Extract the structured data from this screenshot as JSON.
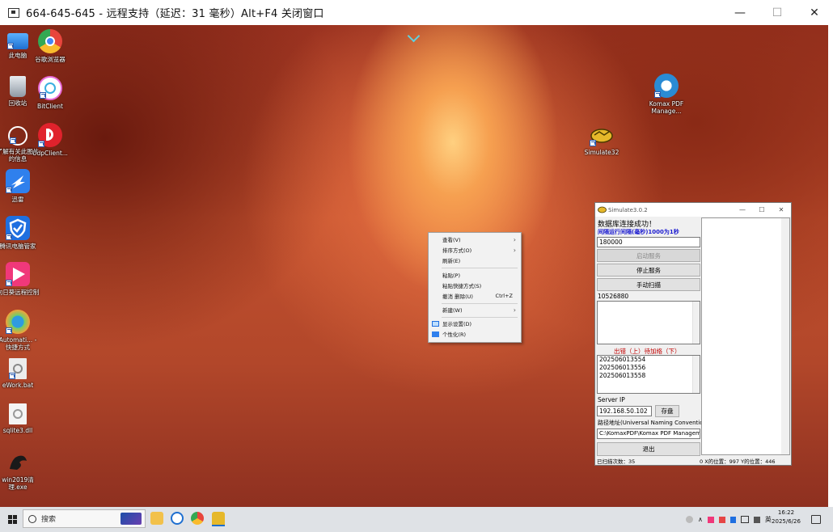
{
  "remote_window": {
    "title": "664-645-645 - 远程支持（延迟：31 毫秒）Alt+F4 关闭窗口",
    "minimize": "—",
    "maximize": "☐",
    "close": "✕"
  },
  "desktop_icons": [
    {
      "label": "此电脑",
      "icon": "computer-icon",
      "color": "#3a8ee6"
    },
    {
      "label": "谷歌浏览器",
      "icon": "chrome-icon",
      "color": "#e8453c"
    },
    {
      "label": "回收站",
      "icon": "recycle-bin-icon",
      "color": "#9aa6b2"
    },
    {
      "label": "BitClient",
      "icon": "bitclient-icon",
      "color": "#e86bd8"
    },
    {
      "label": "了解有关此图片的信息",
      "icon": "info-circle-icon",
      "color": "#ffffff"
    },
    {
      "label": "UdpClient...",
      "icon": "udpclient-icon",
      "color": "#e0222c"
    },
    {
      "label": "迅雷",
      "icon": "thunder-icon",
      "color": "#2f80ed"
    },
    {
      "label": "腾讯电脑管家",
      "icon": "shield-icon",
      "color": "#1f6fe0"
    },
    {
      "label": "向日葵远程控制",
      "icon": "sunlogin-icon",
      "color": "#f0387a"
    },
    {
      "label": "Automati... - 快捷方式",
      "icon": "automation-icon",
      "color": "#f2a23a"
    },
    {
      "label": "eWork.bat",
      "icon": "bat-file-icon",
      "color": "#dcdcdc"
    },
    {
      "label": "sqlite3.dll",
      "icon": "dll-file-icon",
      "color": "#dcdcdc"
    },
    {
      "label": "win2019清理.exe",
      "icon": "dragon-exe-icon",
      "color": "#222222"
    },
    {
      "label": "Komax PDF Manage...",
      "icon": "komax-pdf-icon",
      "color": "#2a8bd4"
    },
    {
      "label": "Simulate32",
      "icon": "simulate-icon",
      "color": "#e6b82a"
    }
  ],
  "context_menu": {
    "items": [
      {
        "label": "查看(V)",
        "submenu": true
      },
      {
        "label": "排序方式(O)",
        "submenu": true
      },
      {
        "label": "刷新(E)"
      },
      {
        "label": "粘贴(P)"
      },
      {
        "label": "粘贴快捷方式(S)"
      },
      {
        "label": "撤消 删除(U)",
        "shortcut": "Ctrl+Z"
      },
      {
        "label": "新建(W)",
        "submenu": true
      },
      {
        "label": "显示设置(D)",
        "icon": "display-settings-icon"
      },
      {
        "label": "个性化(R)",
        "icon": "personalize-icon"
      }
    ],
    "submenu_arrow": "›"
  },
  "simulate_window": {
    "title": "Simulate3.0.2",
    "minimize": "—",
    "maximize": "☐",
    "close": "✕",
    "db_status": "数据库连接成功！",
    "interval_label": "间隔运行间隔(毫秒)1000为1秒",
    "interval_value": "180000",
    "start_service_btn": "启动服务",
    "stop_service_btn": "停止服务",
    "manual_scan_btn": "手动扫描",
    "counter_value": "10526880",
    "list_header": "出错（上）待加络（下）",
    "list_items": [
      "202506013554",
      "202506013556",
      "202506013558"
    ],
    "server_ip_label": "Server IP",
    "server_ip_value": "192.168.50.102",
    "save_btn": "存盘",
    "path_label": "路径地址(Universal Naming Conventio",
    "path_value": "C:\\KomaxPDF\\Komax PDF Managem",
    "exit_btn": "退出",
    "status_scans": "已扫描次数：35",
    "status_xy": "0 X的位置：997 Y的位置：446"
  },
  "taskbar": {
    "search_placeholder": "搜索",
    "tray_lang": "英",
    "tray_chevron": "∧",
    "time": "16:22",
    "date": "2025/6/26"
  }
}
